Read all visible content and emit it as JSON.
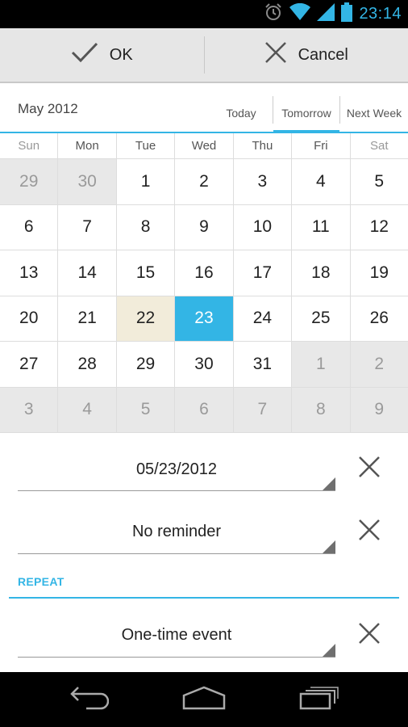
{
  "status_bar": {
    "time": "23:14",
    "icons": [
      "alarm-icon",
      "wifi-icon",
      "signal-icon",
      "battery-icon"
    ],
    "accent_color": "#33b5e5"
  },
  "action_bar": {
    "ok_label": "OK",
    "cancel_label": "Cancel"
  },
  "calendar": {
    "month_title": "May 2012",
    "quick_tabs": [
      "Today",
      "Tomorrow",
      "Next Week"
    ],
    "selected_quick_tab": "Tomorrow",
    "weekdays": [
      "Sun",
      "Mon",
      "Tue",
      "Wed",
      "Thu",
      "Fri",
      "Sat"
    ],
    "weeks": [
      [
        "29",
        "30",
        "1",
        "2",
        "3",
        "4",
        "5"
      ],
      [
        "6",
        "7",
        "8",
        "9",
        "10",
        "11",
        "12"
      ],
      [
        "13",
        "14",
        "15",
        "16",
        "17",
        "18",
        "19"
      ],
      [
        "20",
        "21",
        "22",
        "23",
        "24",
        "25",
        "26"
      ],
      [
        "27",
        "28",
        "29",
        "30",
        "31",
        "1",
        "2"
      ],
      [
        "3",
        "4",
        "5",
        "6",
        "7",
        "8",
        "9"
      ]
    ],
    "today": "22",
    "selected": "23",
    "today_color": "#f2ecda",
    "selected_color": "#33b5e5"
  },
  "form": {
    "date_value": "05/23/2012",
    "reminder_value": "No reminder",
    "repeat_section_label": "REPEAT",
    "repeat_value": "One-time event"
  },
  "nav_bar": {
    "icons": [
      "back-icon",
      "home-icon",
      "recent-apps-icon"
    ]
  }
}
